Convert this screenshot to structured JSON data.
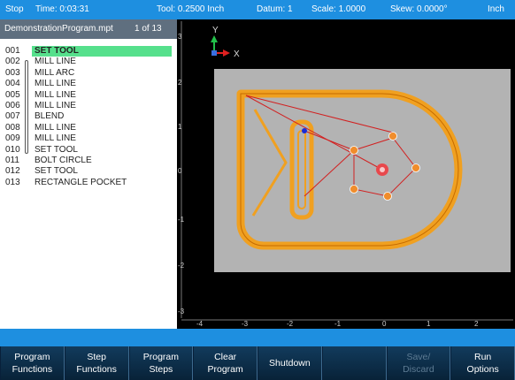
{
  "status": {
    "mode": "Stop",
    "time": "Time: 0:03:31",
    "tool": "Tool: 0.2500 Inch",
    "datum": "Datum: 1",
    "scale": "Scale: 1.0000",
    "skew": "Skew: 0.0000°",
    "units": "Inch"
  },
  "file": {
    "name": "DemonstrationProgram.mpt",
    "position": "1 of 13"
  },
  "program": [
    {
      "num": "001",
      "name": "SET TOOL"
    },
    {
      "num": "002",
      "name": "MILL LINE"
    },
    {
      "num": "003",
      "name": "MILL ARC"
    },
    {
      "num": "004",
      "name": "MILL LINE"
    },
    {
      "num": "005",
      "name": "MILL LINE"
    },
    {
      "num": "006",
      "name": "MILL LINE"
    },
    {
      "num": "007",
      "name": "BLEND"
    },
    {
      "num": "008",
      "name": "MILL LINE"
    },
    {
      "num": "009",
      "name": "MILL LINE"
    },
    {
      "num": "010",
      "name": "SET TOOL"
    },
    {
      "num": "011",
      "name": "BOLT CIRCLE"
    },
    {
      "num": "012",
      "name": "SET TOOL"
    },
    {
      "num": "013",
      "name": "RECTANGLE POCKET"
    }
  ],
  "viewport": {
    "axis_y": "Y",
    "axis_x": "X",
    "ruler_left": [
      "3",
      "2",
      "1",
      "0",
      "-1",
      "-2",
      "-3"
    ],
    "ruler_bottom": [
      "-4",
      "-3",
      "-2",
      "-1",
      "0",
      "1",
      "2"
    ]
  },
  "softkeys": [
    {
      "line1": "Program",
      "line2": "Functions"
    },
    {
      "line1": "Step",
      "line2": "Functions"
    },
    {
      "line1": "Program",
      "line2": "Steps"
    },
    {
      "line1": "Clear",
      "line2": "Program"
    },
    {
      "line1": "Shutdown",
      "line2": ""
    },
    {
      "line1": "",
      "line2": ""
    },
    {
      "line1": "Save/",
      "line2": "Discard"
    },
    {
      "line1": "Run",
      "line2": "Options"
    }
  ],
  "colors": {
    "status_bar": "#1e8fe0",
    "selection": "#56e08c",
    "workpiece": "#b5b5b5",
    "toolpath": "#f0a020",
    "link_line": "#d22020"
  }
}
